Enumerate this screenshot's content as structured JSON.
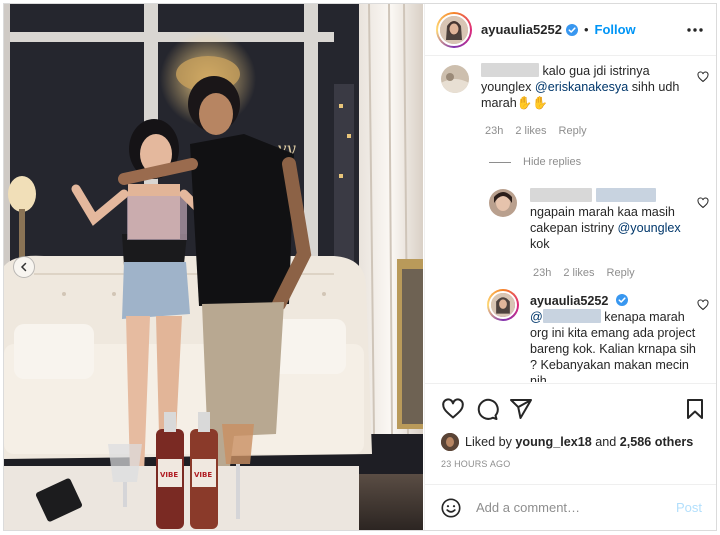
{
  "post": {
    "username": "ayuaulia5252",
    "separator": "•",
    "follow_label": "Follow",
    "more_icon": "more-horizontal-icon",
    "verified_icon": "verified-badge-icon"
  },
  "comments": [
    {
      "text_pre": "kalo gua jdi istrinya",
      "mention": "@eriskanakesya",
      "mention_pre": "younglex",
      "text_post": "sihh udh marah✋✋",
      "time": "23h",
      "likes": "2 likes",
      "reply": "Reply"
    }
  ],
  "hide_replies": "Hide replies",
  "replies": [
    {
      "text": "ngapain marah kaa masih cakepan istriny",
      "mention": "@younglex",
      "text_post": "kok",
      "time": "23h",
      "likes": "2 likes",
      "reply": "Reply"
    },
    {
      "username": "ayuaulia5252",
      "mention": "@",
      "text": "kenapa marah org ini kita emang ada project bareng kok. Kalian krnapa sih ? Kebanyakan makan mecin nih"
    }
  ],
  "actions": {
    "like_icon": "heart-icon",
    "comment_icon": "comment-icon",
    "share_icon": "share-icon",
    "save_icon": "bookmark-icon"
  },
  "likes": {
    "prefix": "Liked by",
    "user": "young_lex18",
    "middle": "and",
    "others": "2,586 others"
  },
  "timestamp": "23 HOURS AGO",
  "composer": {
    "placeholder": "Add a comment…",
    "post_label": "Post"
  },
  "colors": {
    "accent": "#0095f6",
    "mention": "#00376b",
    "muted": "#8e8e8e",
    "post_disabled": "#b2dffc"
  }
}
